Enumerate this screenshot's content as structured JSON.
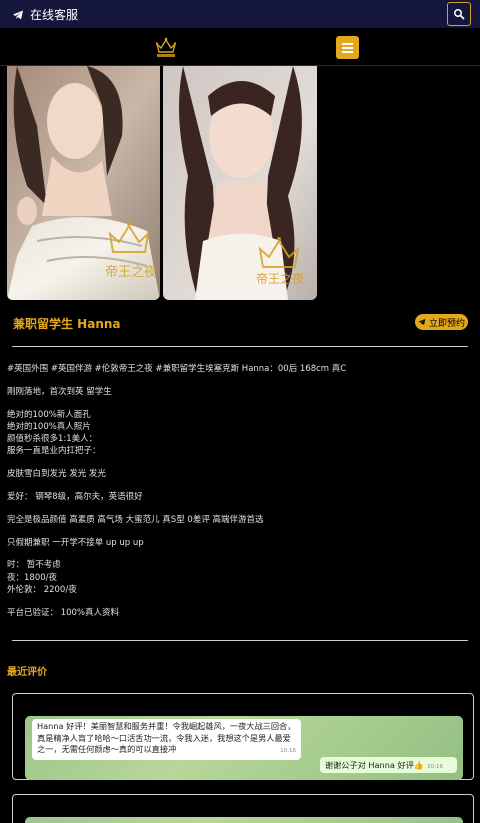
{
  "topbar": {
    "customer_service": "在线客服"
  },
  "header": {
    "logo_name": "帝王之夜"
  },
  "photos": [
    {
      "watermark": "帝王之夜"
    },
    {
      "watermark": "帝王之夜"
    }
  ],
  "profile": {
    "title": "兼职留学生 Hanna",
    "book_label": "立即预约"
  },
  "description": {
    "tags": "#英国外围 #英国伴游 #伦敦帝王之夜 #兼职留学生埃塞克斯 Hanna：00后 168cm 真C",
    "arrival": "刚刚落地，首次到英 留学生",
    "features": [
      "绝对的100%新人面孔",
      "绝对的100%真人照片",
      "颜值秒杀很多1:1美人：",
      "服务一直是业内扛把子："
    ],
    "skin": "皮肤雪白到发光 发光 发光",
    "hobbies": "爱好： 钢琴8级，高尔夫，英语很好",
    "quality": "完全是极品颜值 高素质 高气场 大蜜范儿 真S型 0差评 高端伴游首选",
    "availability": "只假期兼职 一开学不接单 up up up",
    "prices": [
      "时： 暂不考虑",
      "夜：1800/夜",
      "外伦敦： 2200/夜"
    ],
    "verified": "平台已验证： 100%真人资料"
  },
  "reviews": {
    "title": "最近评价",
    "items": [
      {
        "incoming": "Hanna 好评！美丽智慧和服务并重！令我崛起雄风，一夜大战三回合，真是精净人肓了哈哈～口活舌功一流，令我入迷，我想这个是男人最爱之一，无需任何颜虑～真的可以直接冲",
        "incoming_time": "10:16",
        "outgoing": "谢谢公子对 Hanna 好评👍",
        "outgoing_time": "10:16"
      }
    ]
  },
  "colors": {
    "accent": "#e3a81c",
    "topbar_bg": "#14163b",
    "background": "#000000"
  }
}
